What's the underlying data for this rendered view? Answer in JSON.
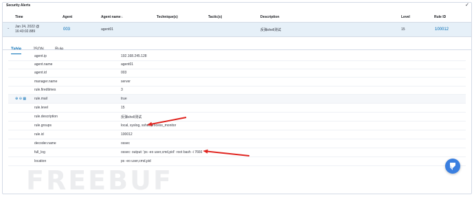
{
  "panel": {
    "title": "Security Alerts"
  },
  "table": {
    "columns": {
      "time": "Time",
      "agent": "Agent",
      "agent_name": "Agent name",
      "technique": "Technique(s)",
      "tactic": "Tactic(s)",
      "description": "Description",
      "level": "Level",
      "rule_id": "Rule ID"
    },
    "row": {
      "time_line1": "Jan 24, 2022 @",
      "time_line2": "16:43:02.889",
      "agent": "003",
      "agent_name": "agent01",
      "technique": "",
      "tactic": "",
      "description": "反弹shell测试",
      "level": "15",
      "rule_id": "100012"
    }
  },
  "tabs": [
    "Table",
    "JSON",
    "Rule"
  ],
  "details": [
    {
      "key": "agent.ip",
      "value": "192.168.245.128"
    },
    {
      "key": "agent.name",
      "value": "agent01"
    },
    {
      "key": "agent.id",
      "value": "003"
    },
    {
      "key": "manager.name",
      "value": "server"
    },
    {
      "key": "rule.firedtimes",
      "value": "3"
    },
    {
      "key": "rule.mail",
      "value": "true"
    },
    {
      "key": "rule.level",
      "value": "15"
    },
    {
      "key": "rule.description",
      "value": "反弹shell测试"
    },
    {
      "key": "rule.groups",
      "value": "local, syslog, sshd, process_monitor"
    },
    {
      "key": "rule.id",
      "value": "100012"
    },
    {
      "key": "decoder.name",
      "value": "ossec"
    },
    {
      "key": "full_log",
      "value": "ossec: output: 'ps -eo user,cmd,pid': root bash -i 7666"
    },
    {
      "key": "location",
      "value": "ps -eo user,cmd,pid"
    }
  ],
  "watermark": "FREEBUF",
  "colors": {
    "accent": "#006bb4",
    "annotation_arrow": "#e0241f",
    "selected_row": "#e6f0f8"
  },
  "icons": {
    "expand": "chevron-down-icon",
    "sort": "arrow-down-icon",
    "fab": "wazuh-logo-icon"
  }
}
